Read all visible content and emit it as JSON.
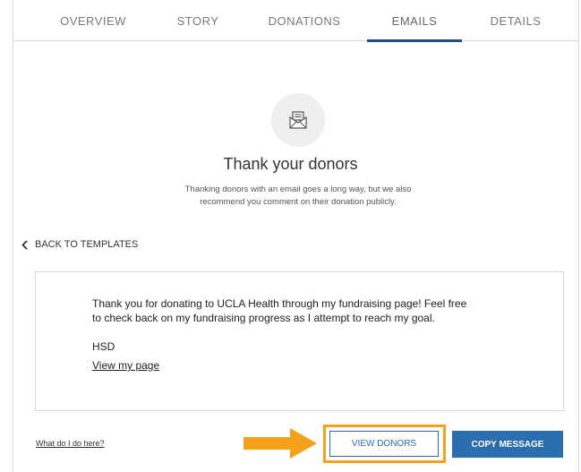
{
  "tabs": [
    {
      "label": "OVERVIEW",
      "active": false
    },
    {
      "label": "STORY",
      "active": false
    },
    {
      "label": "DONATIONS",
      "active": false
    },
    {
      "label": "EMAILS",
      "active": true
    },
    {
      "label": "DETAILS",
      "active": false
    }
  ],
  "hero": {
    "icon": "envelope-letter-icon",
    "title": "Thank your donors",
    "subtitle_line1": "Thanking donors with an email goes a long way, but we also",
    "subtitle_line2": "recommend you comment on their donation publicly."
  },
  "back_link": {
    "icon": "chevron-left-icon",
    "label": "BACK TO TEMPLATES"
  },
  "message": {
    "body_line1": "Thank you for donating to UCLA Health through my fundraising page! Feel free",
    "body_line2": "to check back on my fundraising progress as I attempt to reach my goal.",
    "signature": "HSD",
    "link": "View my page"
  },
  "footer": {
    "help_link": "What do I do here?",
    "view_donors": "VIEW DONORS",
    "copy_message": "COPY MESSAGE"
  },
  "colors": {
    "accent": "#1f4e87",
    "button_blue": "#2a6eb0",
    "highlight_orange": "#f3a21a"
  }
}
